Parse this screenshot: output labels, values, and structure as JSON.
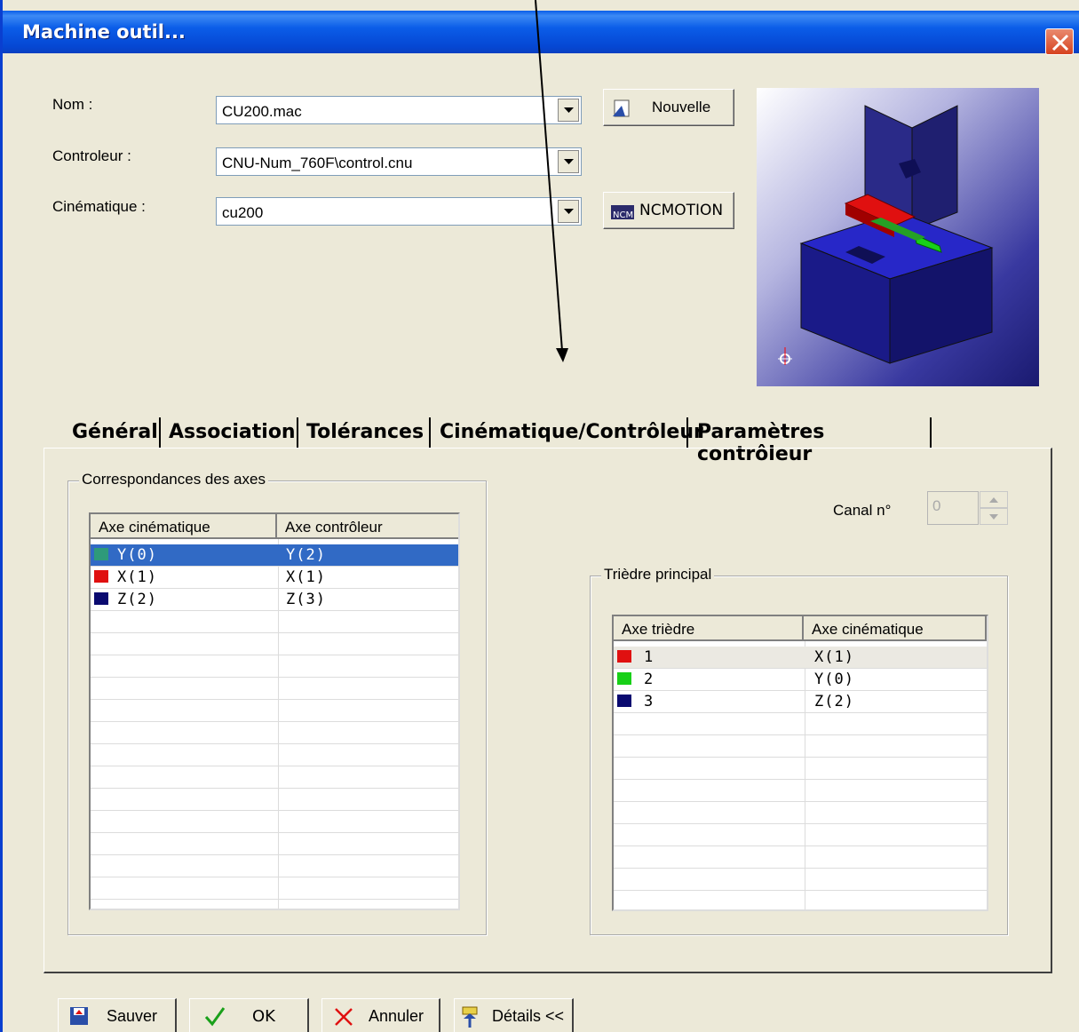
{
  "window": {
    "title": "Machine outil..."
  },
  "form": {
    "nom_label": "Nom :",
    "nom_value": "CU200.mac",
    "controleur_label": "Controleur :",
    "controleur_value": "CNU-Num_760F\\control.cnu",
    "cinematique_label": "Cinématique :",
    "cinematique_value": "cu200",
    "nouvelle_label": "Nouvelle",
    "ncmotion_label": "NCMOTION"
  },
  "tabs": [
    "Général",
    "Association",
    "Tolérances",
    "Cinématique/Contrôleur",
    "Paramètres contrôleur"
  ],
  "axes_group": {
    "legend": "Correspondances des axes",
    "headers": [
      "Axe cinématique",
      "Axe contrôleur"
    ],
    "rows": [
      {
        "kin": "Y(0)",
        "ctrl": "Y(2)",
        "color": "#2e9a7a"
      },
      {
        "kin": "X(1)",
        "ctrl": "X(1)",
        "color": "#e01010"
      },
      {
        "kin": "Z(2)",
        "ctrl": "Z(3)",
        "color": "#0a0a70"
      }
    ]
  },
  "canal": {
    "label": "Canal n°",
    "value": "0"
  },
  "triedre_group": {
    "legend": "Trièdre principal",
    "headers": [
      "Axe trièdre",
      "Axe cinématique"
    ],
    "rows": [
      {
        "axis": "1",
        "kin": "X(1)",
        "color": "#e01010"
      },
      {
        "axis": "2",
        "kin": "Y(0)",
        "color": "#18d018"
      },
      {
        "axis": "3",
        "kin": "Z(2)",
        "color": "#0a0a70"
      }
    ]
  },
  "buttons": {
    "save": "Sauver",
    "ok": "OK",
    "cancel": "Annuler",
    "details": "Détails <<"
  },
  "colors": {
    "titlebar": "#0b5de8",
    "selection": "#316ac5",
    "dialog_bg": "#ece9d8"
  }
}
